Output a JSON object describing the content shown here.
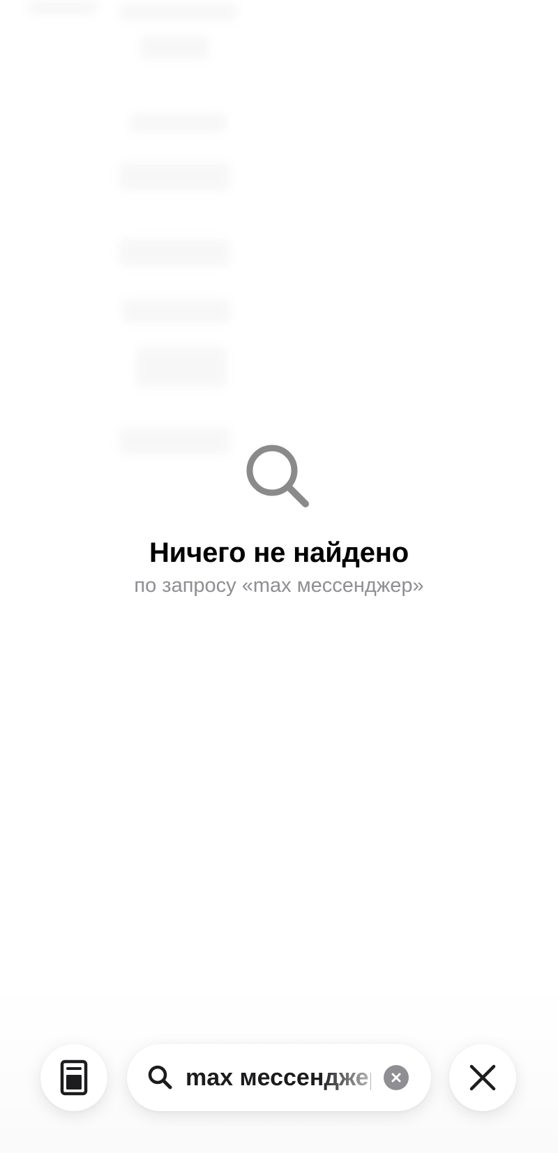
{
  "empty_state": {
    "title": "Ничего не найдено",
    "subtitle": "по запросу «max мессенджер»"
  },
  "toolbar": {
    "search": {
      "query": "max мессенджер"
    }
  },
  "icons": {
    "empty_state": "search-icon",
    "reader": "reader-mode-icon",
    "search": "search-icon",
    "clear": "clear-icon",
    "close": "close-icon"
  },
  "colors": {
    "background": "#ffffff",
    "title": "#000000",
    "subtitle": "#8e8e93",
    "empty_icon": "#8a8a8a",
    "query_text": "#1c1c1e",
    "clear_button": "#8e8e93"
  }
}
